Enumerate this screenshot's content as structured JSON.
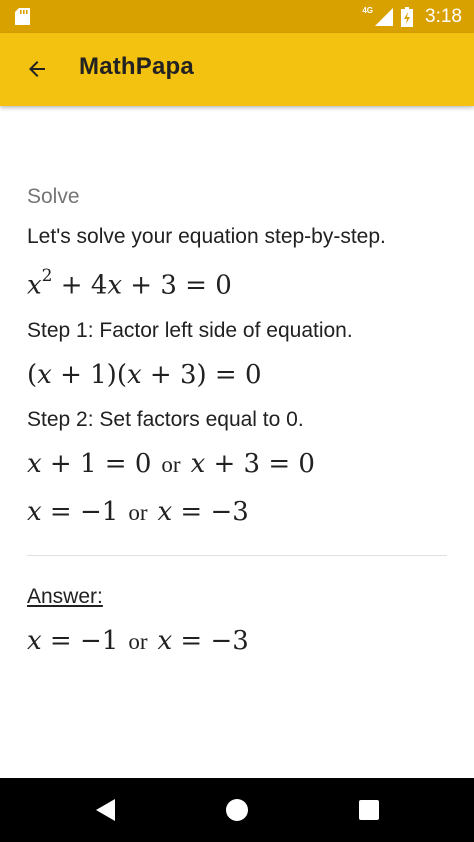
{
  "status_bar": {
    "network": "4G",
    "time": "3:18"
  },
  "app_bar": {
    "title": "MathPapa",
    "back_icon": "arrow-left-icon"
  },
  "solution": {
    "section_label": "Solve",
    "intro": "Let's solve your equation step-by-step.",
    "equation": {
      "base": "x",
      "exponent": "2",
      "rest_a": " + 4",
      "var_b": "x",
      "rest_b": " + 3 = 0"
    },
    "step1": {
      "text": "Step 1: Factor left side of equation.",
      "math": {
        "p1": "(",
        "v1": "x",
        "p2": " + 1)(",
        "v2": "x",
        "p3": " + 3) = 0"
      }
    },
    "step2": {
      "text": "Step 2: Set factors equal to 0.",
      "math_line1": {
        "v1": "x",
        "e1": " + 1 = 0",
        "or": "or",
        "v2": "x",
        "e2": " + 3 = 0"
      },
      "math_line2": {
        "v1": "x",
        "e1": " = −1",
        "or": "or",
        "v2": "x",
        "e2": " = −3"
      }
    },
    "answer": {
      "label": "Answer:",
      "math": {
        "v1": "x",
        "e1": " = −1",
        "or": "or",
        "v2": "x",
        "e2": " = −3"
      }
    }
  },
  "nav_bar": {
    "back": "triangle-back-icon",
    "home": "circle-home-icon",
    "recents": "square-recents-icon"
  },
  "colors": {
    "status_bar": "#d9a100",
    "app_bar": "#f3c211"
  }
}
